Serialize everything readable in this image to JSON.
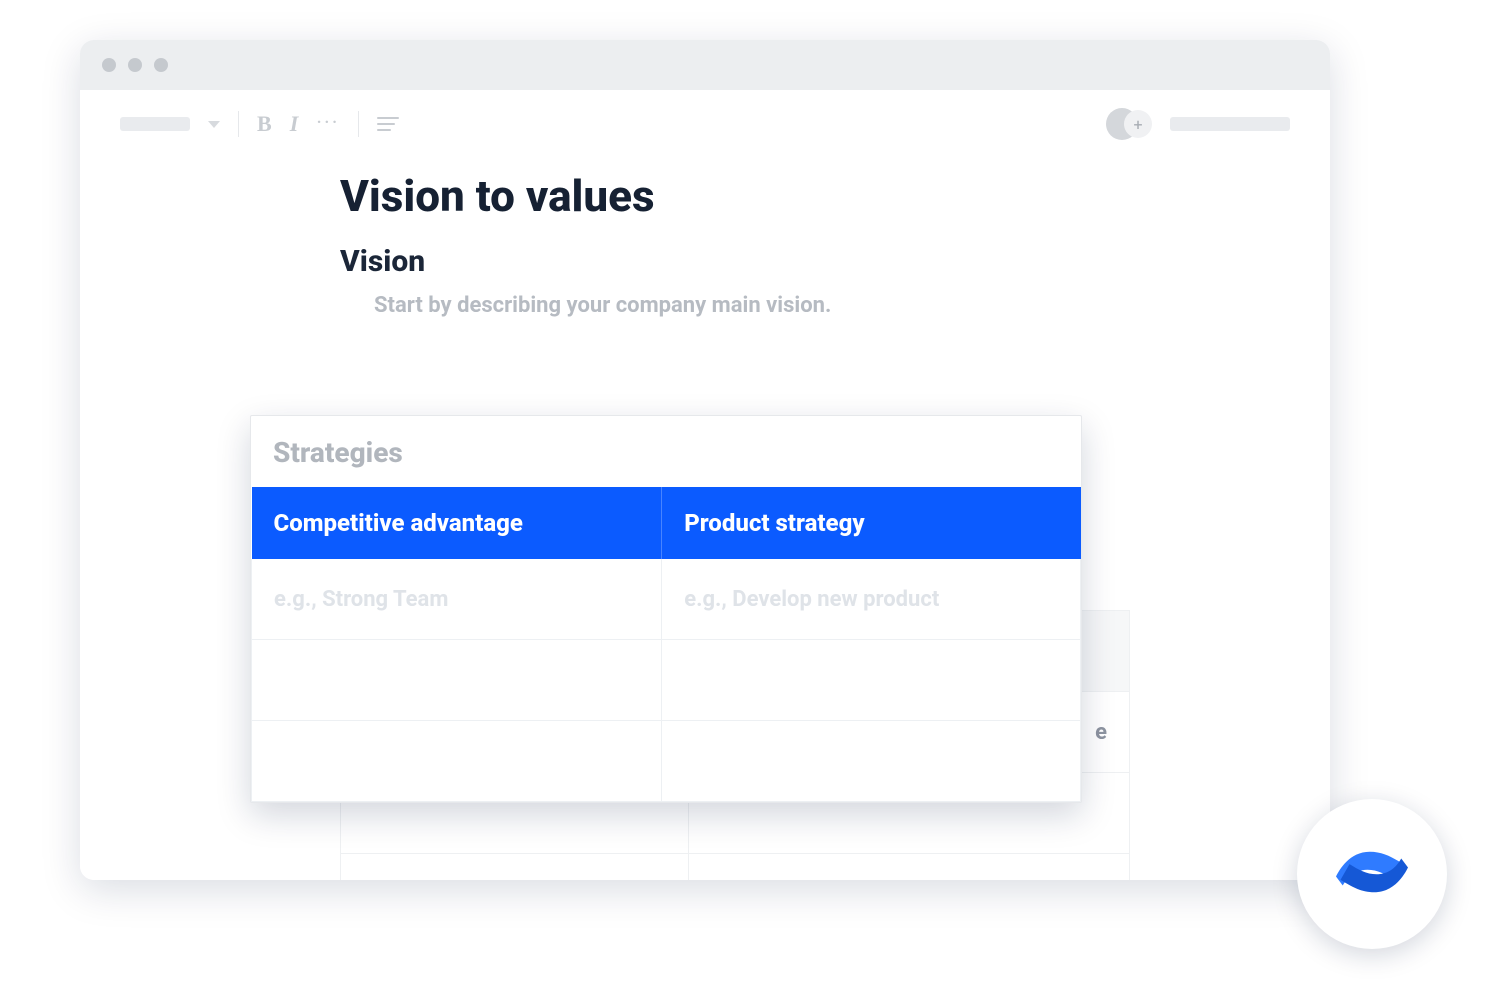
{
  "toolbar": {
    "bold": "B",
    "italic": "I",
    "more": "···",
    "addUserGlyph": "+"
  },
  "document": {
    "title": "Vision to values",
    "sectionHeading": "Vision",
    "visionHint": "Start by describing your company main vision."
  },
  "strategiesCard": {
    "title": "Strategies",
    "columns": [
      "Competitive advantage",
      "Product strategy"
    ],
    "rows": [
      [
        "e.g., Strong Team",
        "e.g., Develop new product"
      ],
      [
        "",
        ""
      ],
      [
        "",
        ""
      ]
    ]
  },
  "backgroundTable": {
    "headerLeft": "",
    "headerRightFragment": "e"
  }
}
